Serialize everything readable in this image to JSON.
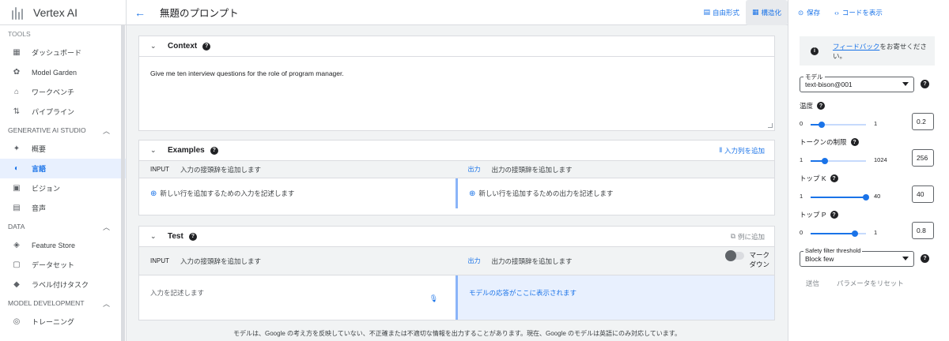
{
  "sidebar": {
    "app_title": "Vertex AI",
    "sections": {
      "tools": "TOOLS",
      "gen_ai": "GENERATIVE AI STUDIO",
      "data": "DATA",
      "model_dev": "MODEL DEVELOPMENT"
    },
    "items": {
      "dashboard": "ダッシュボード",
      "model_garden": "Model Garden",
      "workbench": "ワークベンチ",
      "pipeline": "パイプライン",
      "overview": "概要",
      "language": "言語",
      "vision": "ビジョン",
      "speech": "音声",
      "feature_store": "Feature Store",
      "datasets": "データセット",
      "labeling": "ラベル付けタスク",
      "training": "トレーニング"
    },
    "active": "language",
    "icons": {
      "dashboard": "dashboard-icon",
      "model_garden": "model-garden-icon",
      "workbench": "workbench-icon",
      "pipeline": "pipeline-icon",
      "overview": "sparkle-icon",
      "language": "language-icon",
      "vision": "vision-icon",
      "speech": "speech-icon",
      "feature_store": "feature-store-icon",
      "datasets": "dataset-icon",
      "labeling": "label-icon",
      "training": "training-icon"
    }
  },
  "header": {
    "prompt_title": "無題のプロンプト",
    "freeform": "自由形式",
    "structured": "構造化",
    "selected_mode": "structured"
  },
  "context": {
    "title": "Context",
    "text": "Give me ten interview questions for the role of program manager."
  },
  "examples": {
    "title": "Examples",
    "add_column": "入力列を追加",
    "input_key": "INPUT",
    "input_prefix": "入力の接頭辞を追加します",
    "output_key": "出力",
    "output_prefix": "出力の接頭辞を追加します",
    "add_input_row": "新しい行を追加するための入力を記述します",
    "add_output_row": "新しい行を追加するための出力を記述します"
  },
  "test": {
    "title": "Test",
    "add_example": "例に追加",
    "input_key": "INPUT",
    "input_prefix": "入力の接頭辞を追加します",
    "output_key": "出力",
    "output_prefix": "出力の接頭辞を追加します",
    "markdown_label_1": "マーク",
    "markdown_label_2": "ダウン",
    "input_placeholder": "入力を記述します",
    "response_placeholder": "モデルの応答がここに表示されます"
  },
  "disclaimer": "モデルは、Google の考え方を反映していない、不正確または不適切な情報を出力することがあります。現在、Google のモデルは英語にのみ対応しています。",
  "right_panel": {
    "save": "保存",
    "show_code": "コードを表示",
    "feedback_link": "フィードバック",
    "feedback_rest_1": "をお寄せくださ",
    "feedback_rest_2": "い。",
    "model_label": "モデル",
    "model_value": "text-bison@001",
    "temperature_label": "温度",
    "temperature": {
      "min": "0",
      "max": "1",
      "value": "0.2",
      "fraction": 0.2
    },
    "token_label": "トークンの制限",
    "token": {
      "min": "1",
      "max": "1024",
      "value": "256",
      "fraction": 0.25
    },
    "topk_label": "トップ K",
    "topk": {
      "min": "1",
      "max": "40",
      "value": "40",
      "fraction": 1.0
    },
    "topp_label": "トップ P",
    "topp": {
      "min": "0",
      "max": "1",
      "value": "0.8",
      "fraction": 0.8
    },
    "safety_label": "Safety filter threshold",
    "safety_value": "Block few",
    "submit": "送信",
    "reset": "パラメータをリセット"
  },
  "colors": {
    "accent": "#1a73e8",
    "active_bg": "#e8f0fe"
  }
}
